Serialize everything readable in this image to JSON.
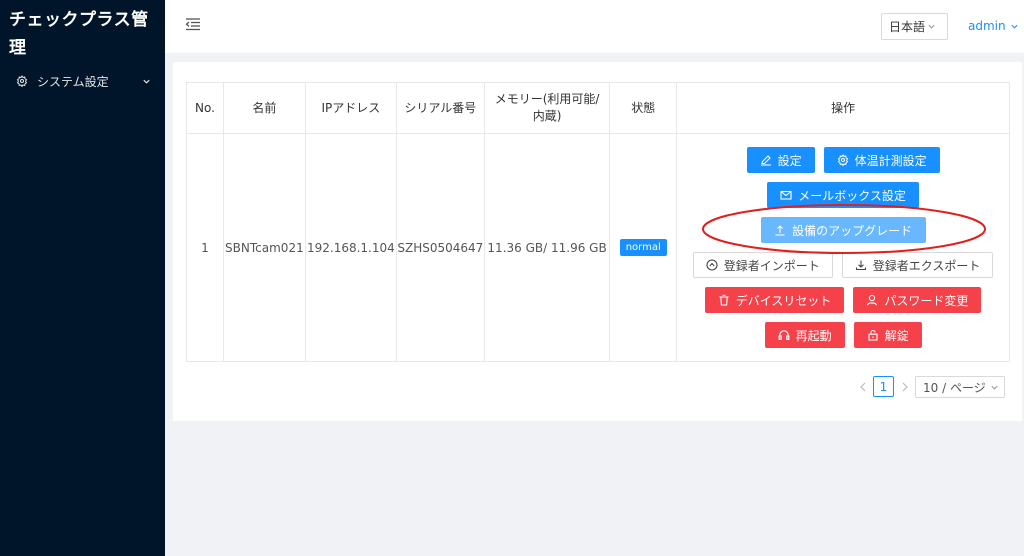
{
  "app": {
    "title": "チェックプラス管理"
  },
  "sidebar": {
    "items": [
      {
        "label": "システム設定",
        "icon": "gear-icon"
      }
    ]
  },
  "header": {
    "language": "日本語",
    "user": "admin"
  },
  "table": {
    "columns": [
      "No.",
      "名前",
      "IPアドレス",
      "シリアル番号",
      "メモリー(利用可能/内蔵)",
      "状態",
      "操作"
    ],
    "rows": [
      {
        "no": "1",
        "name": "SBNTcam021",
        "ip": "192.168.1.104",
        "serial": "SZHS0504647",
        "memory": "11.36 GB/ 11.96 GB",
        "status": "normal"
      }
    ]
  },
  "actions": {
    "settings": "設定",
    "temp_settings": "体温計測設定",
    "mailbox_settings": "メールボックス設定",
    "upgrade": "設備のアップグレード",
    "import_registrants": "登録者インポート",
    "export_registrants": "登録者エクスポート",
    "device_reset": "デバイスリセット",
    "change_password": "パスワード変更",
    "reboot": "再起動",
    "unlock": "解錠"
  },
  "pagination": {
    "current_page": "1",
    "page_size": "10 / ページ"
  },
  "colors": {
    "sidebar": "#001529",
    "primary": "#1890ff",
    "danger": "#f5424a",
    "highlight": "#e02020"
  }
}
